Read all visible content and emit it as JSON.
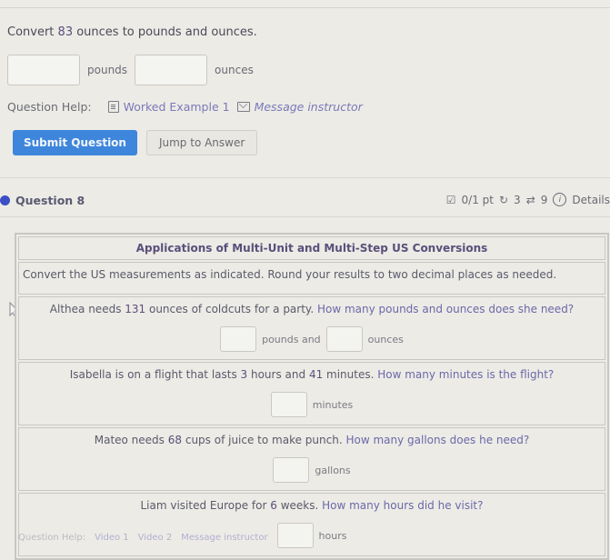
{
  "prev_question": {
    "prompt_prefix": "Convert ",
    "prompt_number": "83",
    "prompt_suffix": " ounces to pounds and ounces.",
    "input1_value": "",
    "unit1": "pounds",
    "input2_value": "",
    "unit2": "ounces",
    "help_label": "Question Help:",
    "help_links": [
      "Worked Example 1",
      "Message instructor"
    ],
    "submit_label": "Submit Question",
    "jump_label": "Jump to Answer"
  },
  "question": {
    "title": "Question 8",
    "score": "0/1 pt",
    "retries": "3",
    "attempts": "9",
    "details_label": "Details",
    "table_title": "Applications of Multi-Unit and Multi-Step US Conversions",
    "instructions": "Convert the US measurements as indicated. Round your results to two decimal places as needed.",
    "items": [
      {
        "pre": "Althea needs ",
        "num": "131",
        "mid": " ounces of coldcuts for a party. ",
        "ask": "How many pounds and ounces does she need?",
        "unit1": "pounds and",
        "unit2": "ounces"
      },
      {
        "pre": "Isabella is on a flight that lasts ",
        "num": "3",
        "mid": " hours and ",
        "num2": "41",
        "mid2": " minutes. ",
        "ask": "How many minutes is the flight?",
        "unit1": "minutes"
      },
      {
        "pre": "Mateo needs ",
        "num": "68",
        "mid": " cups of juice to make punch. ",
        "ask": "How many gallons does he need?",
        "unit1": "gallons"
      },
      {
        "pre": "Liam visited Europe for ",
        "num": "6",
        "mid": " weeks. ",
        "ask": "How many hours did he visit?",
        "unit1": "hours"
      }
    ],
    "bottom_help": [
      "Question Help:",
      "Video 1",
      "Video 2",
      "Message instructor"
    ]
  }
}
